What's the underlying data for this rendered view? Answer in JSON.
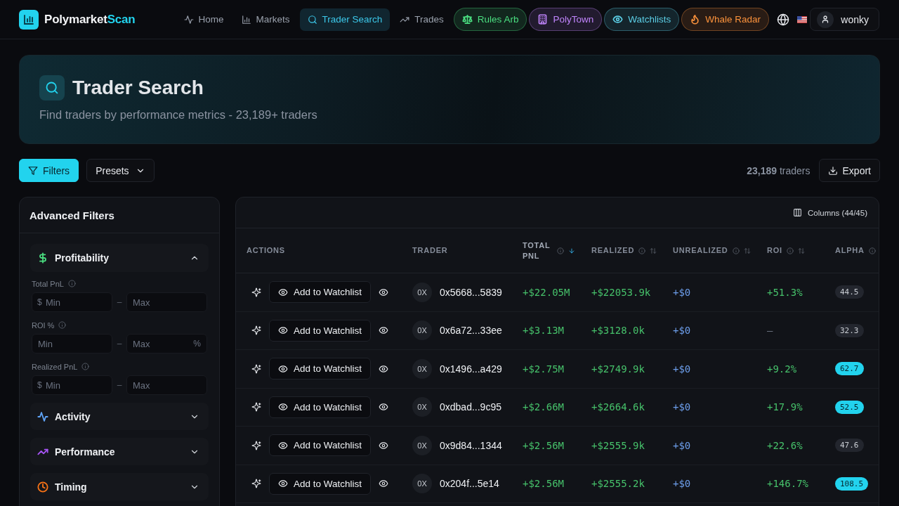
{
  "brand": {
    "name": "Polymarket",
    "accent": "Scan"
  },
  "nav": [
    {
      "label": "Home",
      "selected": false
    },
    {
      "label": "Markets",
      "selected": false
    },
    {
      "label": "Trader Search",
      "selected": true
    },
    {
      "label": "Trades",
      "selected": false
    }
  ],
  "feature_links": [
    {
      "label": "Rules Arb",
      "color": "#4ade80"
    },
    {
      "label": "PolyTown",
      "color": "#c084fc"
    },
    {
      "label": "Watchlists",
      "color": "#5ccfe6"
    },
    {
      "label": "Whale Radar",
      "color": "#fb923c"
    }
  ],
  "user": {
    "name": "wonky"
  },
  "header": {
    "title": "Trader Search",
    "subtitle": "Find traders by performance metrics - 23,189+ traders"
  },
  "toolbar": {
    "filters": {
      "label": "Filters",
      "active": true
    },
    "presets": {
      "label": "Presets"
    },
    "count": "**23,189** traders",
    "export": {
      "label": "Export"
    }
  },
  "filters_panel": {
    "title": "Advanced Filters",
    "sections": [
      {
        "label": "Profitability",
        "color": "#4ade80",
        "expanded": true,
        "fields": [
          {
            "label": "Total PnL",
            "min": {
              "prefix": "$",
              "placeholder": "Min"
            },
            "separator": "–",
            "max": {
              "placeholder": "Max"
            }
          },
          {
            "label": "ROI %",
            "min": {
              "placeholder": "Min"
            },
            "separator": "–",
            "max": {
              "placeholder": "Max",
              "suffix": "%"
            }
          },
          {
            "label": "Realized PnL",
            "min": {
              "prefix": "$",
              "placeholder": "Min"
            },
            "separator": "–",
            "max": {
              "placeholder": "Max"
            }
          }
        ]
      },
      {
        "label": "Activity",
        "color": "#60a5fa",
        "expanded": false
      },
      {
        "label": "Performance",
        "color": "#a855f7",
        "expanded": false
      },
      {
        "label": "Timing",
        "color": "#f97316",
        "expanded": false
      }
    ]
  },
  "table": {
    "columns_button": "Columns (44/45)",
    "columns": [
      {
        "label": "ACTIONS",
        "kind": "plain",
        "sorted": false
      },
      {
        "label": "TRADER",
        "kind": "plain",
        "sorted": false
      },
      {
        "label": "TOTAL PNL",
        "kind": "sortable",
        "sorted": true
      },
      {
        "label": "REALIZED",
        "kind": "sortable",
        "sorted": false
      },
      {
        "label": "UNREALIZED",
        "kind": "sortable",
        "sorted": false
      },
      {
        "label": "ROI",
        "kind": "sortable",
        "sorted": false
      },
      {
        "label": "ALPHA",
        "kind": "info",
        "sorted": false
      }
    ],
    "rows": [
      {
        "action_label": "Add to Watchlist",
        "avatar": "0X",
        "address": "0x5668...5839",
        "total_pnl": "+$22.05M",
        "realized": "+$22053.9k",
        "unrealized": "+$0",
        "roi": "+51.3%",
        "roi_positive": true,
        "alpha": "44.5",
        "alpha_highlighted": false
      },
      {
        "action_label": "Add to Watchlist",
        "avatar": "0X",
        "address": "0x6a72...33ee",
        "total_pnl": "+$3.13M",
        "realized": "+$3128.0k",
        "unrealized": "+$0",
        "roi": "—",
        "roi_positive": false,
        "alpha": "32.3",
        "alpha_highlighted": false
      },
      {
        "action_label": "Add to Watchlist",
        "avatar": "0X",
        "address": "0x1496...a429",
        "total_pnl": "+$2.75M",
        "realized": "+$2749.9k",
        "unrealized": "+$0",
        "roi": "+9.2%",
        "roi_positive": true,
        "alpha": "62.7",
        "alpha_highlighted": true
      },
      {
        "action_label": "Add to Watchlist",
        "avatar": "0X",
        "address": "0xdbad...9c95",
        "total_pnl": "+$2.66M",
        "realized": "+$2664.6k",
        "unrealized": "+$0",
        "roi": "+17.9%",
        "roi_positive": true,
        "alpha": "52.5",
        "alpha_highlighted": true
      },
      {
        "action_label": "Add to Watchlist",
        "avatar": "0X",
        "address": "0x9d84...1344",
        "total_pnl": "+$2.56M",
        "realized": "+$2555.9k",
        "unrealized": "+$0",
        "roi": "+22.6%",
        "roi_positive": true,
        "alpha": "47.6",
        "alpha_highlighted": false
      },
      {
        "action_label": "Add to Watchlist",
        "avatar": "0X",
        "address": "0x204f...5e14",
        "total_pnl": "+$2.56M",
        "realized": "+$2555.2k",
        "unrealized": "+$0",
        "roi": "+146.7%",
        "roi_positive": true,
        "alpha": "108.5",
        "alpha_highlighted": true
      }
    ]
  }
}
